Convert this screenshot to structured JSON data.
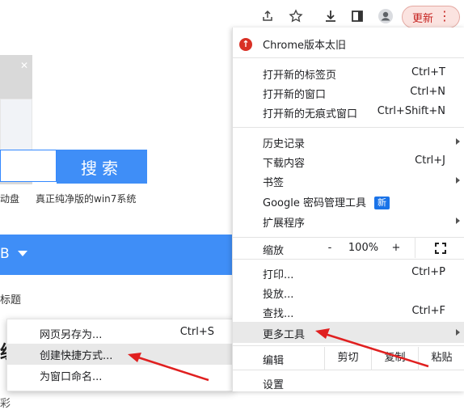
{
  "toolbar": {
    "icons": [
      "share-icon",
      "star-icon",
      "download-icon",
      "sidepanel-icon",
      "profile-icon"
    ],
    "update_label": "更新",
    "menu_dots": "⋮"
  },
  "page": {
    "search_button": "搜索",
    "link_left": "动盘",
    "link_right": "真正纯净版的win7系统",
    "blue_bar_text": "B",
    "gray_text": "标题",
    "big_char": "统",
    "partial_char": "彩"
  },
  "submenu": {
    "items": [
      {
        "label": "网页另存为...",
        "shortcut": "Ctrl+S"
      },
      {
        "label": "创建快捷方式...",
        "shortcut": ""
      },
      {
        "label": "为窗口命名...",
        "shortcut": ""
      }
    ]
  },
  "menu": {
    "chrome_outdated": "Chrome版本太旧",
    "new_tab": {
      "label": "打开新的标签页",
      "shortcut": "Ctrl+T"
    },
    "new_window": {
      "label": "打开新的窗口",
      "shortcut": "Ctrl+N"
    },
    "incognito": {
      "label": "打开新的无痕式窗口",
      "shortcut": "Ctrl+Shift+N"
    },
    "history": {
      "label": "历史记录"
    },
    "downloads": {
      "label": "下载内容",
      "shortcut": "Ctrl+J"
    },
    "bookmarks": {
      "label": "书签"
    },
    "passwords": {
      "label": "Google 密码管理工具",
      "badge": "新"
    },
    "extensions": {
      "label": "扩展程序"
    },
    "zoom": {
      "label": "缩放",
      "minus": "-",
      "value": "100%",
      "plus": "+"
    },
    "print": {
      "label": "打印...",
      "shortcut": "Ctrl+P"
    },
    "cast": {
      "label": "投放..."
    },
    "find": {
      "label": "查找...",
      "shortcut": "Ctrl+F"
    },
    "more_tools": {
      "label": "更多工具"
    },
    "edit": {
      "label": "编辑",
      "cut": "剪切",
      "copy": "复制",
      "paste": "粘贴"
    },
    "settings": {
      "label": "设置"
    }
  },
  "colors": {
    "accent": "#3f8ef7",
    "update": "#c5221f",
    "arrow": "#e02020"
  }
}
